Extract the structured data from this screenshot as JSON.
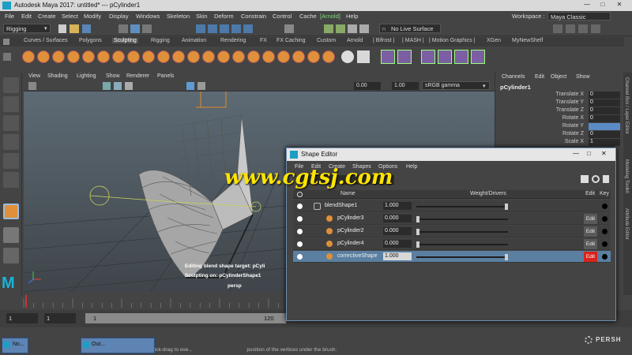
{
  "app": {
    "title": "Autodesk Maya 2017: untitled*   ---   pCylinder1",
    "workspace_label": "Workspace :",
    "workspace_value": "Maya Classic"
  },
  "menubar": [
    "File",
    "Edit",
    "Create",
    "Select",
    "Modify",
    "Display",
    "Windows",
    "Skeleton",
    "Skin",
    "Deform",
    "Constrain",
    "Control",
    "Cache",
    "[Arnold]",
    "Help"
  ],
  "statusline": {
    "menuset": "Rigging",
    "live_surface": "No Live Surface"
  },
  "shelf_tabs": [
    "Curves / Surfaces",
    "Polygons",
    "Sculpting",
    "Rigging",
    "Animation",
    "Rendering",
    "FX",
    "FX Caching",
    "Custom",
    "Arnold",
    "| Bifrost |",
    "| MASH |",
    "| Motion Graphics |",
    "XGen",
    "MyNewShelf"
  ],
  "shelf_active": "Sculpting",
  "viewport": {
    "menu": [
      "View",
      "Shading",
      "Lighting",
      "Show",
      "Renderer",
      "Panels"
    ],
    "field1": "0.00",
    "field2": "1.00",
    "colorspace": "sRGB gamma",
    "hud_line1": "Editing blend shape target: pCyli",
    "hud_line2": "Sculpting on: pCylinderShape1",
    "camera": "persp"
  },
  "channelbox": {
    "menu": [
      "Channels",
      "Edit",
      "Object",
      "Show"
    ],
    "object": "pCylinder1",
    "attributes": [
      {
        "name": "Translate X",
        "value": "0"
      },
      {
        "name": "Translate Y",
        "value": "0"
      },
      {
        "name": "Translate Z",
        "value": "0"
      },
      {
        "name": "Rotate X",
        "value": "0"
      },
      {
        "name": "Rotate Y",
        "value": ""
      },
      {
        "name": "Rotate Z",
        "value": "0"
      },
      {
        "name": "Scale X",
        "value": "1"
      }
    ],
    "side_tabs": [
      "Channel Box / Layer Editor",
      "Modeling Toolkit",
      "Attribute Editor"
    ]
  },
  "shape_editor": {
    "title": "Shape Editor",
    "menu": [
      "File",
      "Edit",
      "Create",
      "Shapes",
      "Options",
      "Help"
    ],
    "columns": {
      "name": "Name",
      "weight": "Weight/Drivers",
      "edit": "Edit",
      "key": "Key"
    },
    "rows": [
      {
        "name": "blendShape1",
        "value": "1.000",
        "weight": 1.0,
        "edit": "",
        "selected": false,
        "level": 0
      },
      {
        "name": "pCylinder3",
        "value": "0.000",
        "weight": 0.0,
        "edit": "Edit",
        "selected": false,
        "level": 1
      },
      {
        "name": "pCylinder2",
        "value": "0.000",
        "weight": 0.0,
        "edit": "Edit",
        "selected": false,
        "level": 1
      },
      {
        "name": "pCylinder4",
        "value": "0.000",
        "weight": 0.0,
        "edit": "Edit",
        "selected": false,
        "level": 1
      },
      {
        "name": "correctiveShape",
        "value": "1.000",
        "weight": 1.0,
        "edit": "Edit",
        "selected": true,
        "level": 1
      }
    ]
  },
  "timeline": {
    "start": "1",
    "current": "1",
    "range_start": "1",
    "range_end": "120"
  },
  "watermark": "www.cgtsj.com",
  "help_line": "Smooth Tool: Click-drag to eve...                                      position of the vertices under the brush.",
  "taskbar": [
    "No...",
    "Out..."
  ],
  "logo_text": "PERSH"
}
